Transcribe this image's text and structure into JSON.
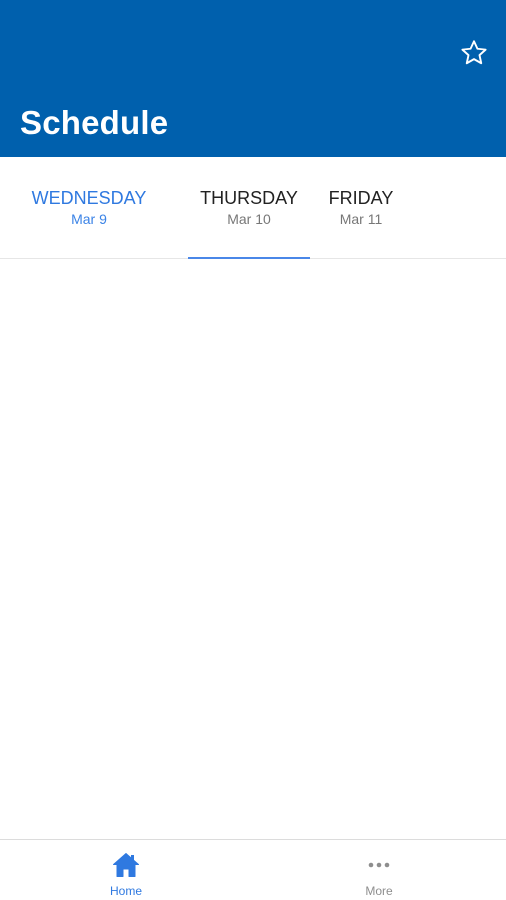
{
  "header": {
    "title": "Schedule",
    "favorite_icon": "star-outline-icon",
    "background_color": "#0060ad"
  },
  "tabs": [
    {
      "day": "WEDNESDAY",
      "date": "Mar 9",
      "state": "today"
    },
    {
      "day": "THURSDAY",
      "date": "Mar 10",
      "state": "selected"
    },
    {
      "day": "FRIDAY",
      "date": "Mar 11",
      "state": "normal"
    }
  ],
  "accent_color": "#2f79e0",
  "tabbar": {
    "items": [
      {
        "label": "Home",
        "icon": "home-icon",
        "active": true
      },
      {
        "label": "More",
        "icon": "more-dots-icon",
        "active": false
      }
    ]
  }
}
